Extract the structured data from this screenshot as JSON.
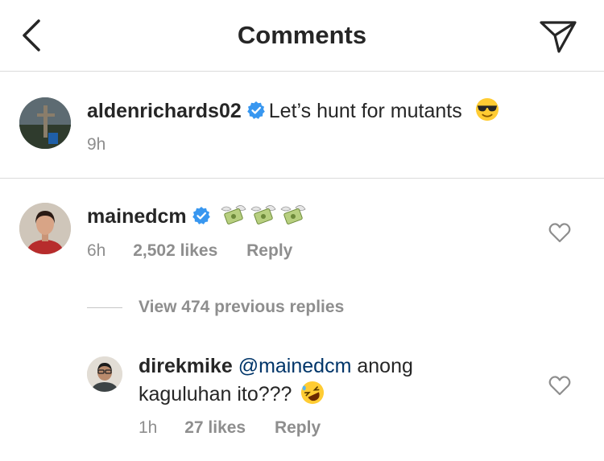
{
  "header": {
    "title": "Comments",
    "back_icon": "chevron-left-icon",
    "send_icon": "paper-plane-icon"
  },
  "caption": {
    "username": "aldenrichards02",
    "verified": true,
    "text": "Let’s hunt for mutants",
    "emoji": "smiling-face-with-sunglasses",
    "time": "9h"
  },
  "comments": [
    {
      "username": "mainedcm",
      "verified": true,
      "emoji": "money-with-wings x3",
      "time": "6h",
      "likes": "2,502 likes",
      "reply": "Reply"
    }
  ],
  "view_replies": "View 474 previous replies",
  "reply": {
    "username": "direkmike",
    "mention": "@mainedcm",
    "text_line1": "anong",
    "text_line2": "kaguluhan ito???",
    "emoji": "rolling-on-the-floor-laughing",
    "time": "1h",
    "likes": "27 likes",
    "reply": "Reply"
  },
  "colors": {
    "verified_blue": "#3897f0",
    "mention": "#003569",
    "meta_gray": "#8e8e8e",
    "divider": "#dbdbdb"
  }
}
